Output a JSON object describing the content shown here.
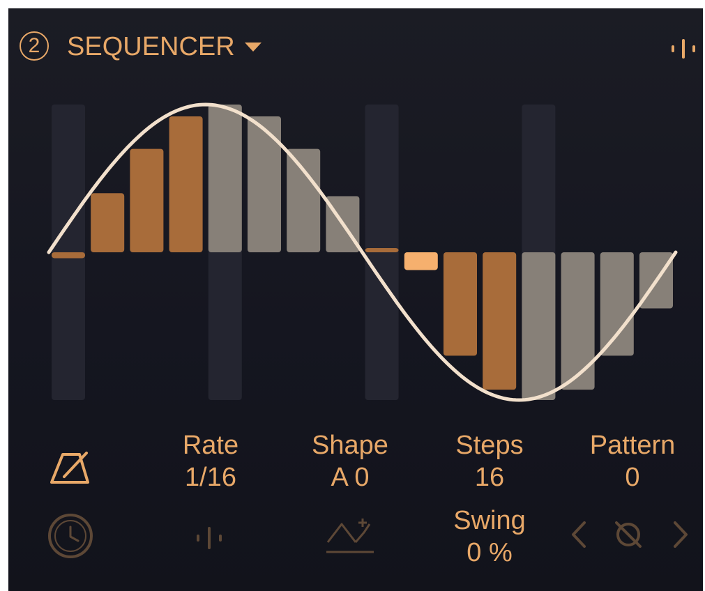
{
  "header": {
    "slot_number": "2",
    "title": "SEQUENCER"
  },
  "sequencer": {
    "accent_color": "#e8a868",
    "step_active_color": "#a86c3a",
    "step_inactive_color": "#878078",
    "step_current_color": "#f6b06e",
    "curve_color": "#f2e0cc",
    "steps_total": 16,
    "step_values": [
      -0.04,
      0.4,
      0.7,
      0.92,
      1.0,
      0.92,
      0.7,
      0.38,
      0.0,
      -0.12,
      -0.7,
      -0.93,
      -1.0,
      -0.93,
      -0.7,
      -0.38
    ],
    "step_states": [
      "active",
      "active",
      "active",
      "active",
      "inactive",
      "inactive",
      "inactive",
      "inactive",
      "active",
      "current",
      "active",
      "active",
      "inactive",
      "inactive",
      "inactive",
      "inactive"
    ]
  },
  "params": {
    "rate": {
      "label": "Rate",
      "value": "1/16"
    },
    "shape": {
      "label": "Shape",
      "value": "A 0"
    },
    "steps": {
      "label": "Steps",
      "value": "16"
    },
    "pattern": {
      "label": "Pattern",
      "value": "0"
    },
    "swing": {
      "label": "Swing",
      "value": "0 %"
    }
  },
  "icons": {
    "sync": "metronome-icon",
    "clock": "clock-icon",
    "wave": "waveform-icon",
    "shape_add": "shape-add-icon",
    "prev": "chevron-left-icon",
    "reset": "no-pattern-icon",
    "next": "chevron-right-icon"
  }
}
